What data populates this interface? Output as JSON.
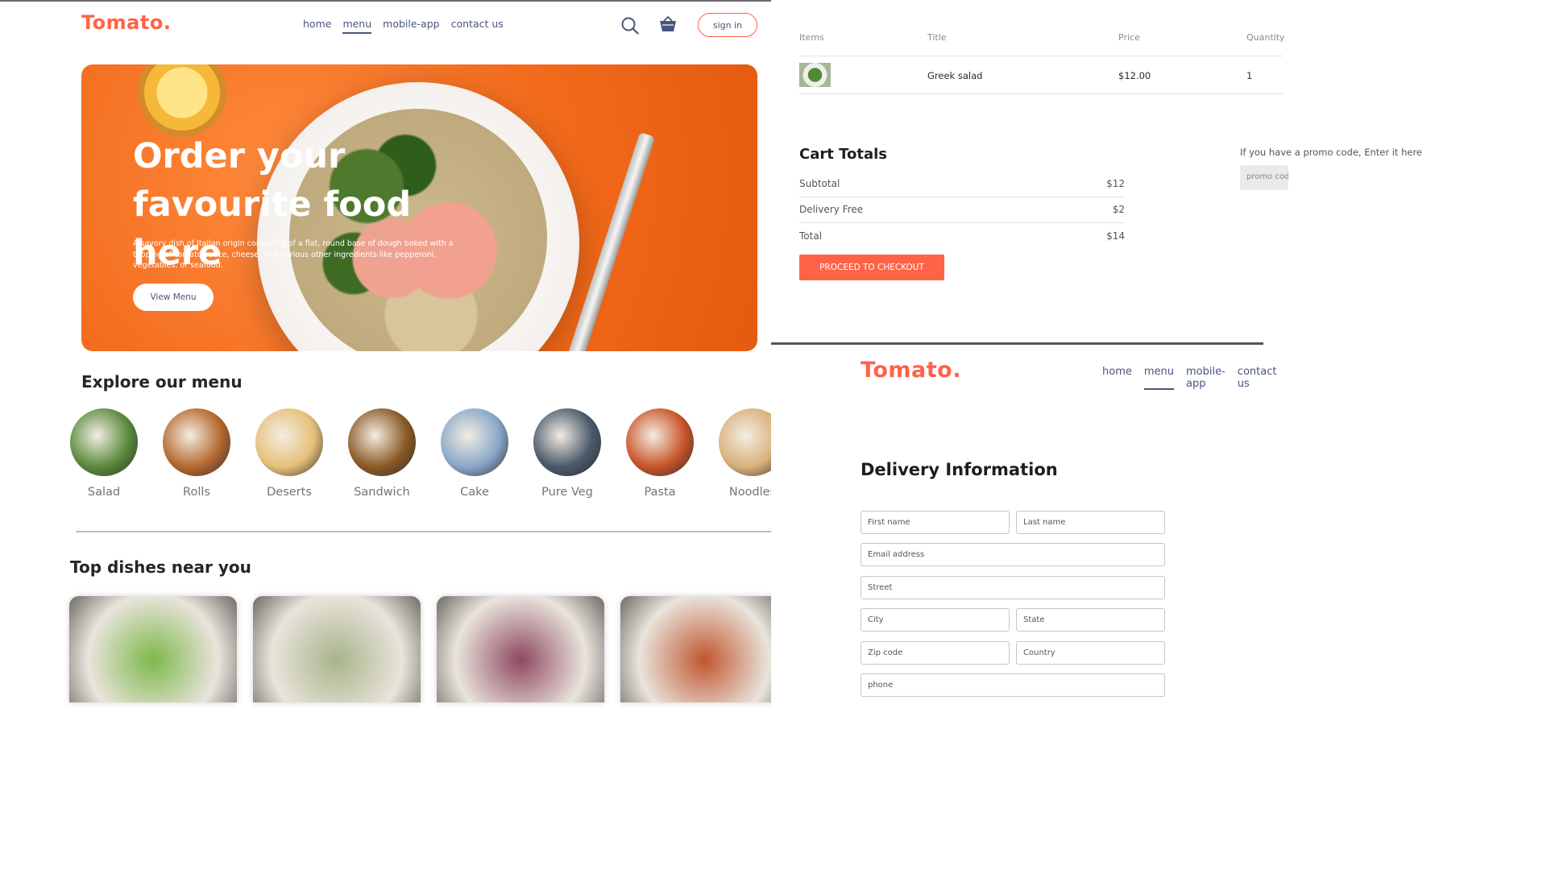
{
  "home": {
    "logo": "Tomato.",
    "nav": [
      "home",
      "menu",
      "mobile-app",
      "contact us"
    ],
    "active_nav": "menu",
    "signin_label": "sign in",
    "hero": {
      "title_line1": "Order your",
      "title_line2": "favourite food here",
      "description": "A savory dish of Italian origin consisting of a flat, round base of dough baked with a topping of tomato sauce, cheese, and various other ingredients like pepperoni, vegetables, or seafood.",
      "button_label": "View Menu"
    },
    "explore_title": "Explore our menu",
    "menu_items": [
      {
        "label": "Salad",
        "color": "#5b8a3c"
      },
      {
        "label": "Rolls",
        "color": "#b5682e"
      },
      {
        "label": "Deserts",
        "color": "#e6c07a"
      },
      {
        "label": "Sandwich",
        "color": "#8a5a26"
      },
      {
        "label": "Cake",
        "color": "#8aa7c9"
      },
      {
        "label": "Pure Veg",
        "color": "#4a5a6a"
      },
      {
        "label": "Pasta",
        "color": "#c9552a"
      },
      {
        "label": "Noodles",
        "color": "#d9b07a"
      }
    ],
    "top_dishes_title": "Top dishes near you",
    "dishes": [
      {
        "color": "#7db84a"
      },
      {
        "color": "#a8b48a"
      },
      {
        "color": "#8e4860"
      },
      {
        "color": "#c0552f"
      }
    ]
  },
  "cart": {
    "headers": [
      "Items",
      "Title",
      "Price",
      "Quantity"
    ],
    "row": {
      "title": "Greek salad",
      "price": "$12.00",
      "quantity": "1"
    },
    "totals_title": "Cart Totals",
    "subtotal_label": "Subtotal",
    "subtotal_value": "$12",
    "delivery_label": "Delivery Free",
    "delivery_value": "$2",
    "total_label": "Total",
    "total_value": "$14",
    "checkout_label": "PROCEED TO CHECKOUT",
    "promo_text": "If you have a promo code, Enter it here",
    "promo_placeholder": "promo code"
  },
  "delivery": {
    "logo": "Tomato.",
    "nav": [
      "home",
      "menu",
      "mobile-app",
      "contact us"
    ],
    "title": "Delivery Information",
    "fields": {
      "first_name": "First name",
      "last_name": "Last name",
      "email": "Email address",
      "street": "Street",
      "city": "City",
      "state": "State",
      "zip": "Zip code",
      "country": "Country",
      "phone": "phone"
    }
  },
  "colors": {
    "brand": "#ff6347",
    "nav_text": "#49557e"
  }
}
